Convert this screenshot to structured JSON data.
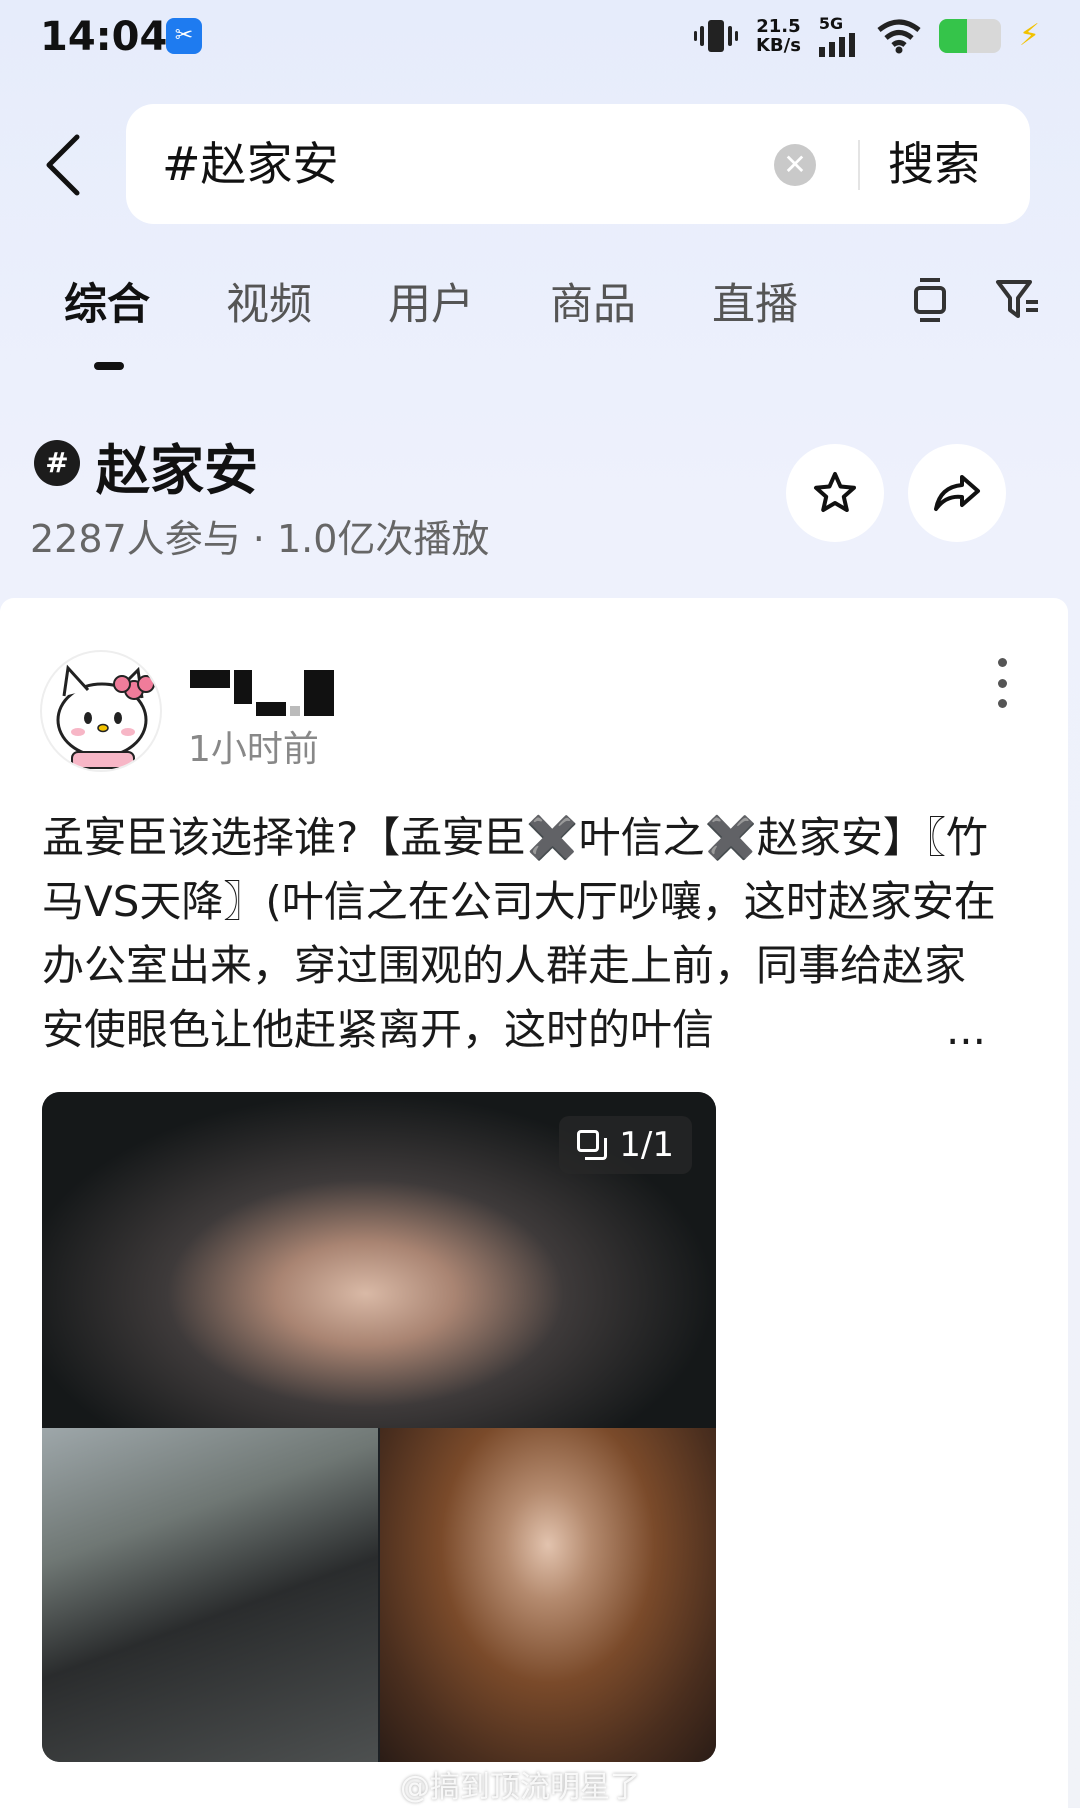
{
  "status_bar": {
    "time": "14:04",
    "net_speed": "21.5",
    "net_speed_unit": "KB/s",
    "network": "5G",
    "battery_level": 0.45,
    "app_icon": "scissors-app-icon",
    "colors": {
      "battery": "#35c44a",
      "charging": "#f2c200",
      "app_icon_bg": "#1e7bf0"
    }
  },
  "search": {
    "query": "#赵家安",
    "button_label": "搜索",
    "back_icon": "chevron-left-icon",
    "clear_icon": "clear-icon"
  },
  "tabs": {
    "items": [
      {
        "label": "综合",
        "active": true
      },
      {
        "label": "视频",
        "active": false
      },
      {
        "label": "用户",
        "active": false
      },
      {
        "label": "商品",
        "active": false
      },
      {
        "label": "直播",
        "active": false
      }
    ],
    "icons": [
      "layout-icon",
      "filter-icon"
    ]
  },
  "topic": {
    "badge": "#",
    "title": "赵家安",
    "stats": "2287人参与 · 1.0亿次播放",
    "actions": [
      "star-icon",
      "share-icon"
    ]
  },
  "post": {
    "author_avatar": "hello-kitty-avatar",
    "time": "1小时前",
    "text": "孟宴臣该选择谁?【孟宴臣✖️叶信之✖️赵家安】〖竹马VS天降〗(叶信之在公司大厅吵嚷，这时赵家安在办公室出来，穿过围观的人群走上前，同事给赵家安使眼色让他赶紧离开，这时的叶信",
    "ellipsis": "...",
    "image_counter": "1/1"
  },
  "watermark": "@搞到顶流明星了"
}
